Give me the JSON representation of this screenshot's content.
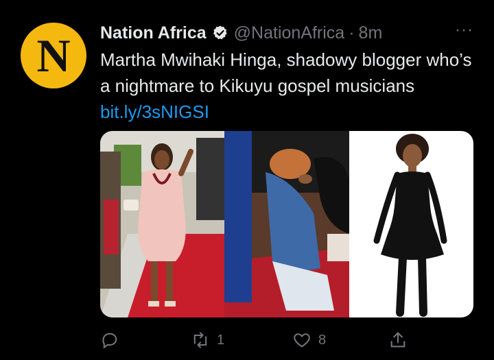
{
  "tweet": {
    "author_initial": "N",
    "author_name": "Nation Africa",
    "handle": "@NationAfrica",
    "separator": "·",
    "time": "8m",
    "more": "···",
    "text": "Martha Mwihaki Hinga, shadowy blogger who’s a nightmare to Kikuyu gospel musicians ",
    "link": "bit.ly/3sNIGSI",
    "retweets": "1",
    "likes": "8"
  },
  "colors": {
    "avatar_bg": "#f5b80f",
    "link": "#1d9bf0",
    "muted": "#71767b",
    "verified_badge": "#e7e9ea"
  },
  "icons": [
    "verified-icon",
    "reply-icon",
    "retweet-icon",
    "like-icon",
    "share-icon"
  ]
}
